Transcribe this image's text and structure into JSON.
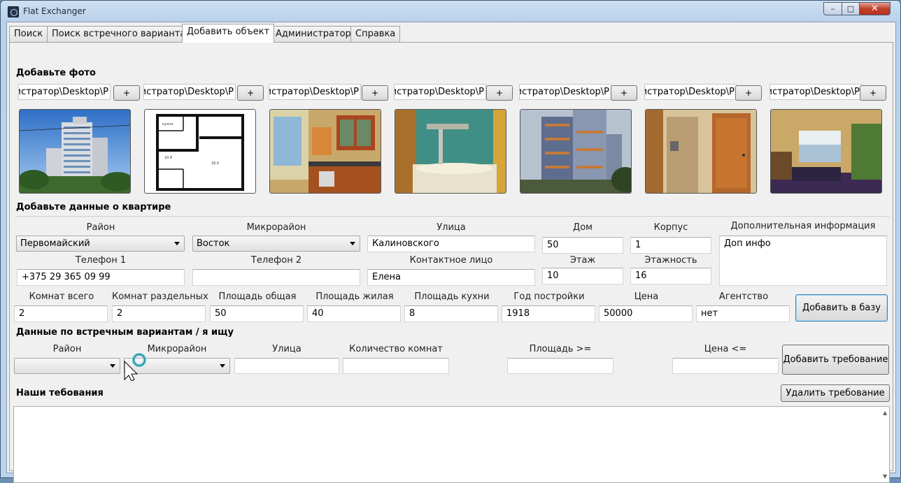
{
  "window": {
    "title": "Flat Exchanger",
    "min": "–",
    "max": "□",
    "close": "✕"
  },
  "tabs": [
    "Поиск",
    "Поиск встречного варианта",
    "Добавить объект",
    "Администратор",
    "Справка"
  ],
  "photos": {
    "section": "Добавьте фото",
    "paths": [
      "инистратор\\Desktop\\Р",
      "инистратор\\Desktop\\Р",
      "инистратор\\Desktop\\Р",
      "инистратор\\Desktop\\Р",
      "инистратор\\Desktop\\Р",
      "инистратор\\Desktop\\Р",
      "инистратор\\Desktop\\Р"
    ],
    "plus": "+"
  },
  "flat": {
    "section": "Добавьте данные о квартире",
    "labels": {
      "district": "Район",
      "microdistrict": "Микрорайон",
      "street": "Улица",
      "house": "Дом",
      "building": "Корпус",
      "extra": "Дополнительная информация",
      "phone1": "Телефон 1",
      "phone2": "Телефон 2",
      "contact": "Контактное лицо",
      "floor": "Этаж",
      "floors": "Этажность"
    },
    "values": {
      "district": "Первомайский",
      "microdistrict": "Восток",
      "street": "Калиновского",
      "house": "50",
      "building": "1",
      "extra": "Доп инфо",
      "phone1": "+375 29 365 09 99",
      "phone2": "",
      "contact": "Елена",
      "floor": "10",
      "floors": "16"
    },
    "labels2": {
      "rooms": "Комнат всего",
      "separate": "Комнат раздельных",
      "total_area": "Площадь общая",
      "living_area": "Площадь жилая",
      "kitchen_area": "Площадь кухни",
      "year": "Год постройки",
      "price": "Цена",
      "agency": "Агентство"
    },
    "values2": {
      "rooms": "2",
      "separate": "2",
      "total_area": "50",
      "living_area": "40",
      "kitchen_area": "8",
      "year": "1918",
      "price": "50000",
      "agency": "нет"
    },
    "add_button": "Добавить в базу"
  },
  "counter": {
    "section": "Данные по встречным вариантам / я ищу",
    "labels": {
      "district": "Район",
      "microdistrict": "Микрорайон",
      "street": "Улица",
      "rooms": "Количество комнат",
      "area": "Площадь >=",
      "price": "Цена <="
    },
    "add_button": "Добавить требование"
  },
  "requirements": {
    "section": "Наши тебования",
    "delete_button": "Удалить требование"
  }
}
